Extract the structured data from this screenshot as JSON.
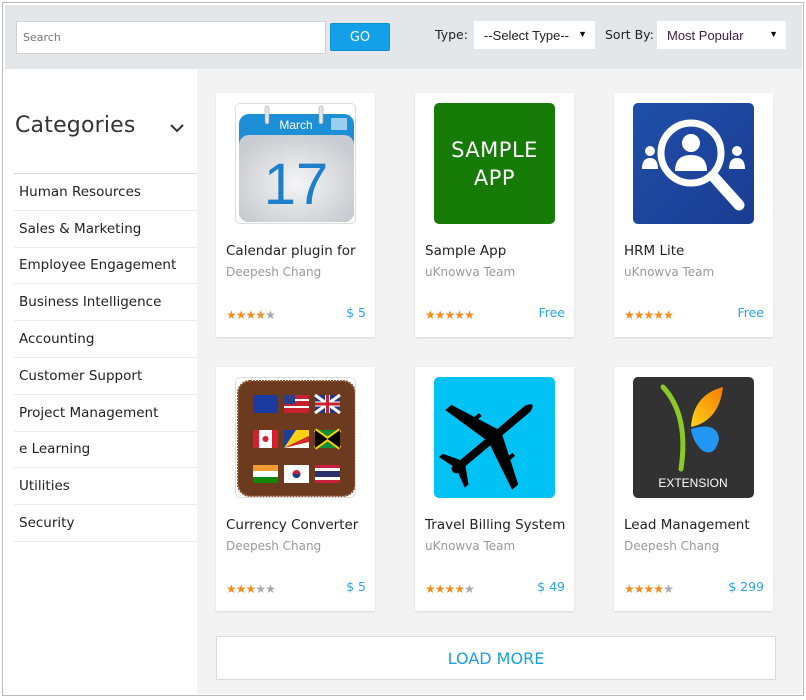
{
  "search": {
    "placeholder": "Search",
    "go_label": "GO"
  },
  "filters": {
    "type_label": "Type:",
    "type_value": "--Select Type--",
    "sort_label": "Sort By:",
    "sort_value": "Most Popular"
  },
  "sidebar": {
    "title": "Categories",
    "toggle_icon": "chevron-down-icon",
    "items": [
      {
        "label": "Human Resources"
      },
      {
        "label": "Sales & Marketing"
      },
      {
        "label": "Employee Engagement"
      },
      {
        "label": "Business Intelligence"
      },
      {
        "label": "Accounting"
      },
      {
        "label": "Customer Support"
      },
      {
        "label": "Project Management"
      },
      {
        "label": "e Learning"
      },
      {
        "label": "Utilities"
      },
      {
        "label": "Security"
      }
    ]
  },
  "apps": [
    {
      "title": "Calendar plugin for",
      "author": "Deepesh Chang",
      "rating": 4,
      "max_rating": 5,
      "price": "$ 5",
      "icon": "calendar-icon",
      "icon_month": "March",
      "icon_day": "17"
    },
    {
      "title": "Sample App",
      "author": "uKnowva Team",
      "rating": 5,
      "max_rating": 5,
      "price": "Free",
      "icon": "sample-app-icon",
      "icon_line1": "SAMPLE",
      "icon_line2": "APP"
    },
    {
      "title": "HRM Lite",
      "author": "uKnowva Team",
      "rating": 5,
      "max_rating": 5,
      "price": "Free",
      "icon": "people-search-icon"
    },
    {
      "title": "Currency Converter",
      "author": "Deepesh Chang",
      "rating": 3,
      "max_rating": 5,
      "price": "$ 5",
      "icon": "flags-icon"
    },
    {
      "title": "Travel Billing System",
      "author": "uKnowva Team",
      "rating": 4,
      "max_rating": 5,
      "price": "$ 49",
      "icon": "airplane-icon"
    },
    {
      "title": "Lead Management",
      "author": "Deepesh Chang",
      "rating": 4,
      "max_rating": 5,
      "price": "$ 299",
      "icon": "extension-icon",
      "icon_label": "EXTENSION"
    }
  ],
  "load_more_label": "LOAD MORE",
  "colors": {
    "accent": "#13a0e8",
    "price": "#2ba6e6",
    "star_on": "#f68b1f",
    "star_off": "#a9a9a9"
  }
}
